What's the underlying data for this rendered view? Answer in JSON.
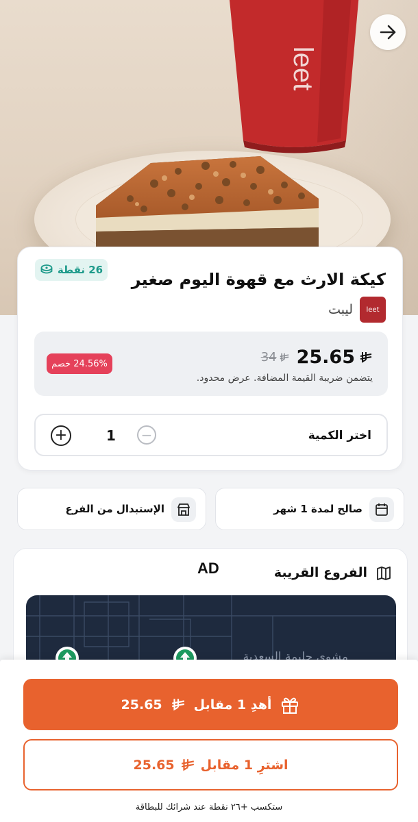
{
  "hero": {
    "cup_brand": "leet"
  },
  "nav": {
    "back_icon": "arrow-right-icon"
  },
  "product": {
    "points_label": "26 نقطة",
    "title": "كيكة الارث مع قهوة اليوم صغير",
    "brand_name": "ليبت",
    "brand_logo_text": "leet",
    "price_now": "25.65",
    "price_old": "34",
    "vat_note": "يتضمن ضريبة القيمة المضافة. عرض محدود.",
    "discount_label": "24.56% خصم",
    "currency_icon": "saudi-riyal-icon"
  },
  "quantity": {
    "label": "اختر الكمية",
    "value": "1",
    "plus": "+",
    "minus": "−"
  },
  "chips": {
    "validity": "صالح لمدة 1 شهر",
    "redeem": "الإستبدال من الفرع"
  },
  "branches": {
    "title": "الفروع القريبة",
    "ad_label": "AD",
    "map_text": "مشوي حليمة السعدية"
  },
  "actions": {
    "gift_label": "أهدِ 1 مقابل",
    "gift_price": "25.65",
    "buy_label": "اشترِ 1 مقابل",
    "buy_price": "25.65",
    "earn_note": "ستكسب +٢٦ نقطة عند شرائك للبطاقة"
  },
  "colors": {
    "accent": "#e8622e",
    "teal": "#1d9a8a",
    "discount": "#e5415a",
    "brand": "#b22a2f"
  }
}
